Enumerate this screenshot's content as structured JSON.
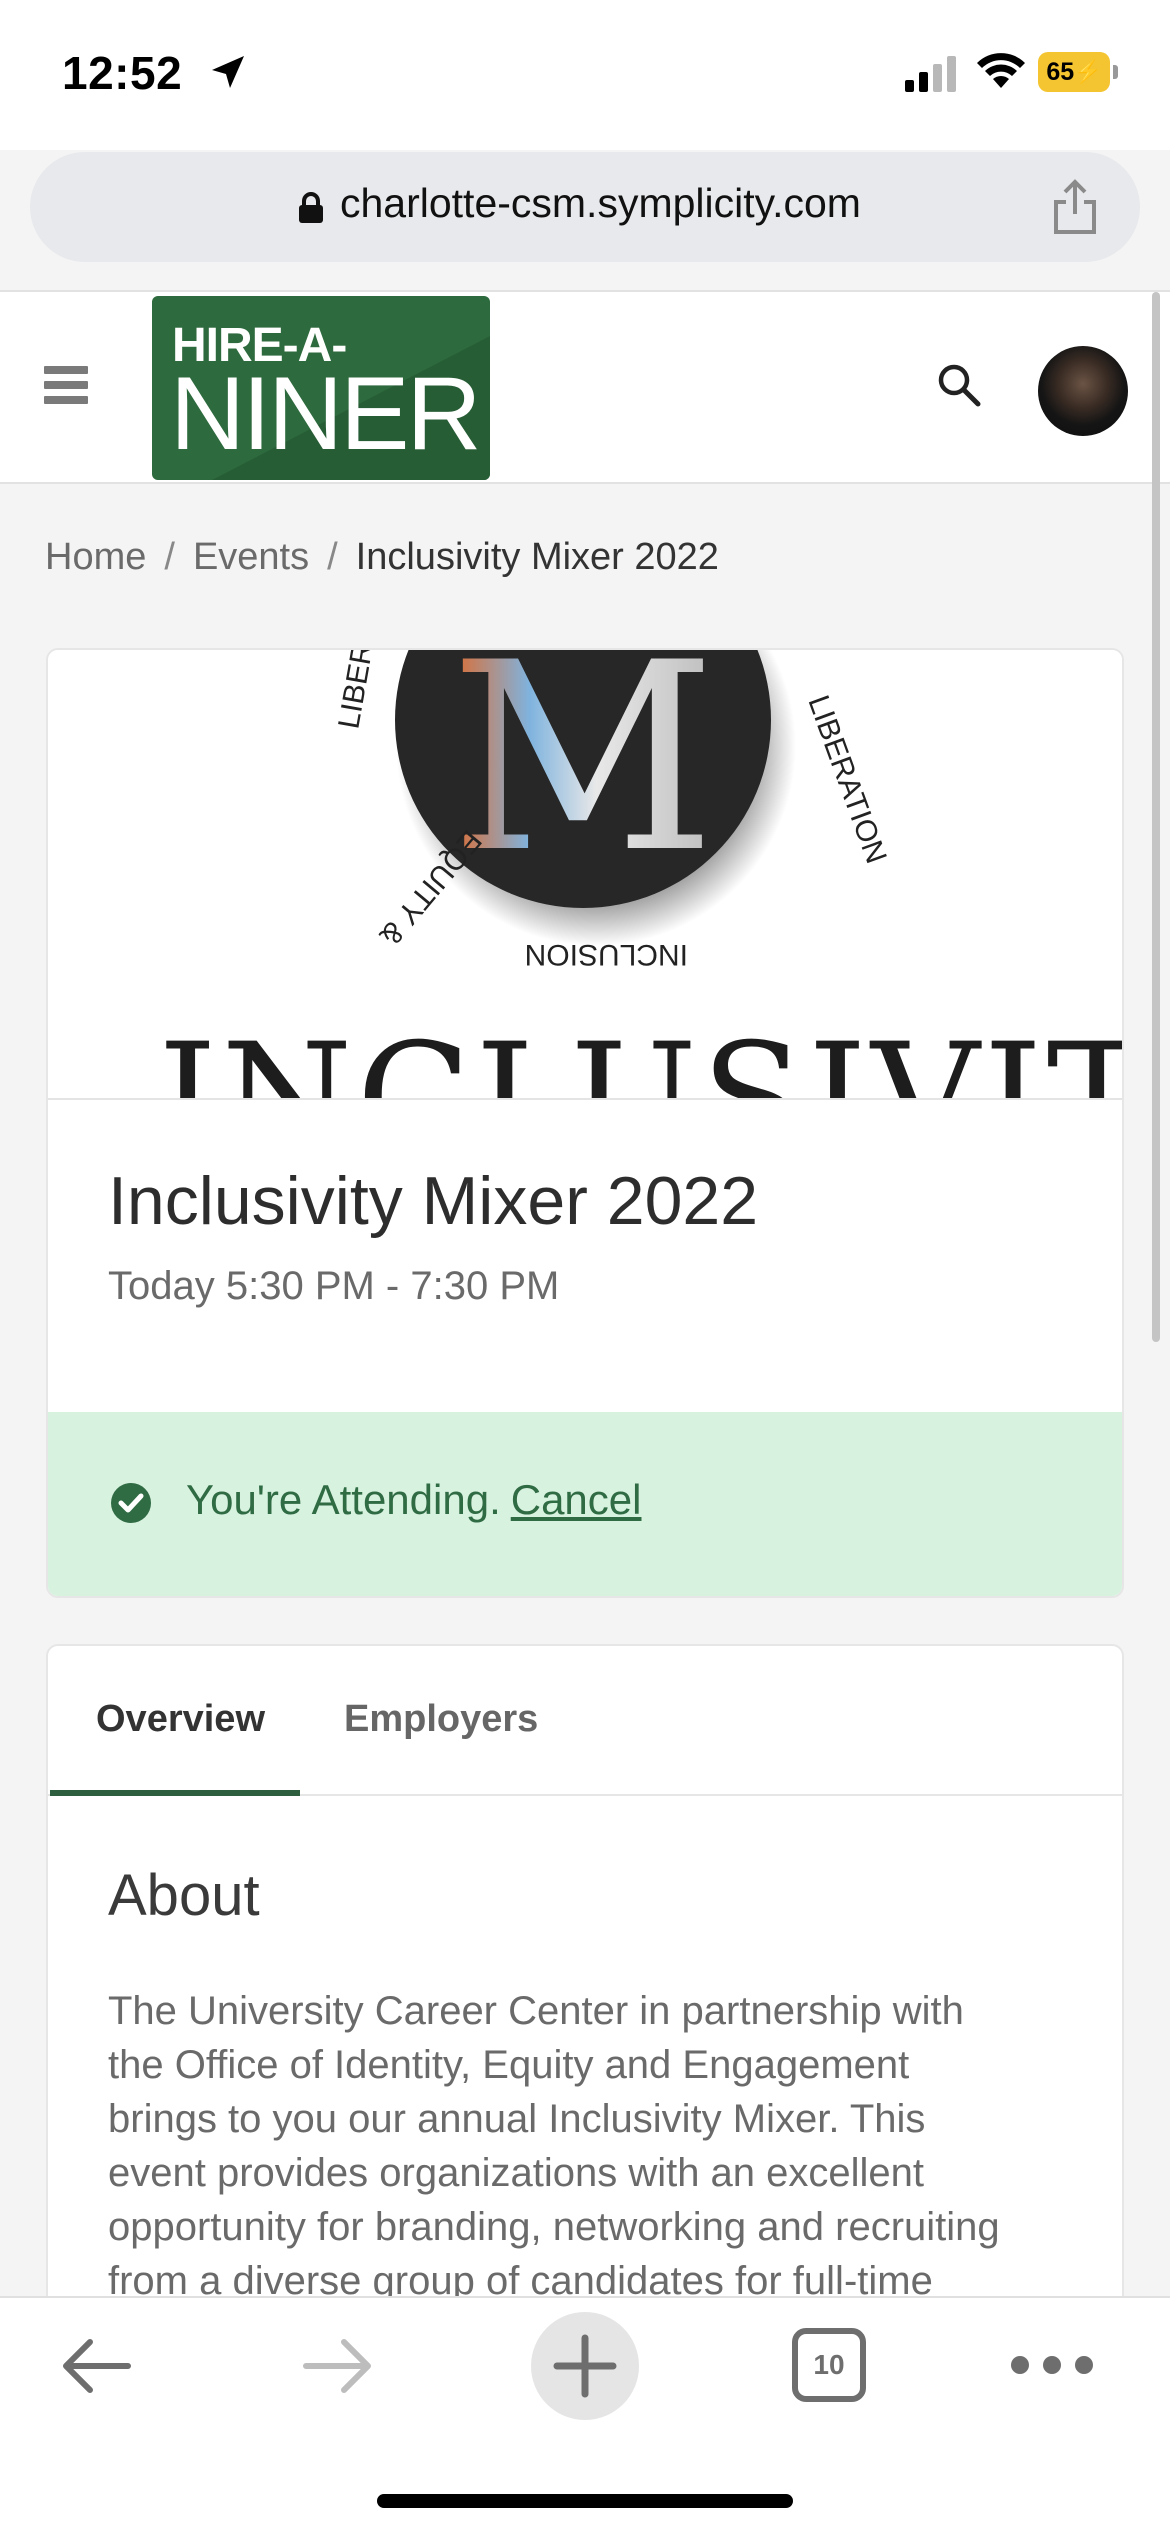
{
  "status_bar": {
    "time": "12:52",
    "battery": "65"
  },
  "browser": {
    "url": "charlotte-csm.symplicity.com",
    "tab_count": "10"
  },
  "site_header": {
    "logo_line1": "HIRE-A-",
    "logo_line2": "NINER"
  },
  "breadcrumb": {
    "items": [
      "Home",
      "Events",
      "Inclusivity Mixer 2022"
    ],
    "separator": "/"
  },
  "event": {
    "banner": {
      "ring_text_right": "LIBERATION",
      "ring_text_left": "LIBER",
      "ring_text_bottom": "INCLUSION",
      "ring_text_lower_left": "EQUITY &",
      "monogram": "M",
      "wordmark": "INCLUSIVITY"
    },
    "title": "Inclusivity Mixer 2022",
    "time": "Today 5:30 PM - 7:30 PM",
    "attendance_status": "You're Attending.",
    "cancel_label": "Cancel",
    "status_color": "#2f6b43"
  },
  "tabs": [
    {
      "label": "Overview",
      "active": true
    },
    {
      "label": "Employers",
      "active": false
    }
  ],
  "about": {
    "heading": "About",
    "body_lines": [
      "The University Career Center in partnership with",
      "the Office of Identity, Equity and Engagement",
      "brings to you our annual Inclusivity Mixer. This",
      "event provides organizations with an excellent",
      "opportunity for branding, networking and recruiting",
      "from a diverse group of candidates for full-time"
    ]
  },
  "colors": {
    "brand_green": "#2d6a3d",
    "success_bg": "#d8f2e0",
    "tab_underline": "#2d5e3d"
  }
}
